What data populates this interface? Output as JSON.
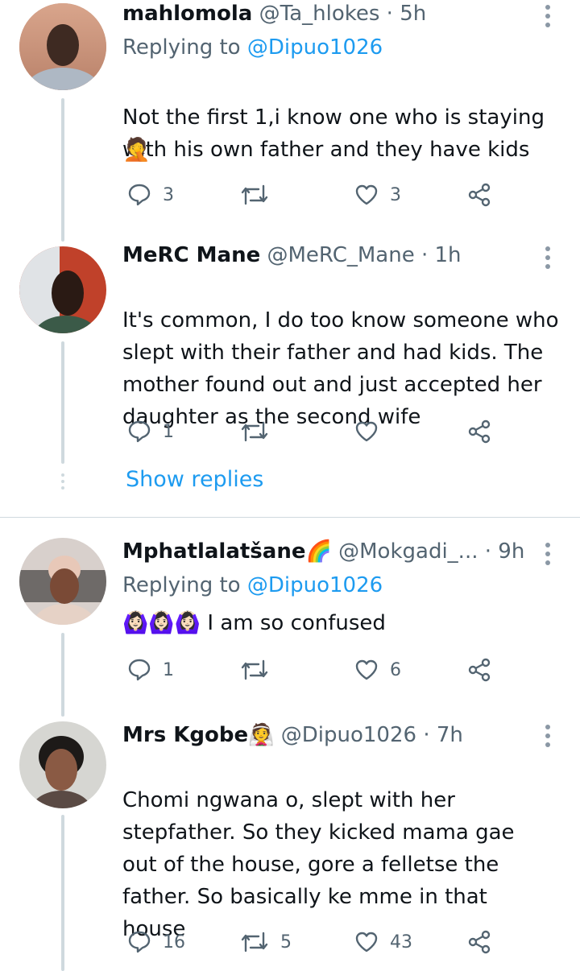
{
  "tweets": [
    {
      "name": "mahlomola",
      "handle": "@Ta_hlokes",
      "time": "5h",
      "replying_label": "Replying to",
      "replying_to": "@Dipuo1026",
      "text": "Not the first 1,i know one who is staying with his own father and they have kids",
      "emoji": "🤦",
      "replies": "3",
      "retweets": "",
      "likes": "3"
    },
    {
      "name": "MeRC Mane",
      "handle": "@MeRC_Mane",
      "time": "1h",
      "text": "It's common, I do too know someone who slept with their father and had kids. The mother found out and just accepted her daughter as the second wife",
      "replies": "1",
      "retweets": "",
      "likes": ""
    },
    {
      "name": "Mphatlalatšane",
      "name_emoji": "🌈",
      "handle": "@Mokgadi_...",
      "time": "9h",
      "replying_label": "Replying to",
      "replying_to": "@Dipuo1026",
      "emoji": "🙆🏻‍♀️🙆🏻‍♀️🙆🏻‍♀️",
      "text": "I am so confused",
      "replies": "1",
      "retweets": "",
      "likes": "6"
    },
    {
      "name": "Mrs Kgobe",
      "name_emoji": "👰",
      "handle": "@Dipuo1026",
      "time": "7h",
      "text": "Chomi ngwana o, slept with her stepfather. So they kicked mama gae out of the house, gore a felletse the father. So basically ke mme in that house",
      "replies": "16",
      "retweets": "5",
      "likes": "43"
    }
  ],
  "show_replies": "Show replies",
  "time_sep": "·",
  "colors": {
    "accent": "#1d9bf0",
    "muted": "#536471",
    "line": "#cfd9de"
  }
}
